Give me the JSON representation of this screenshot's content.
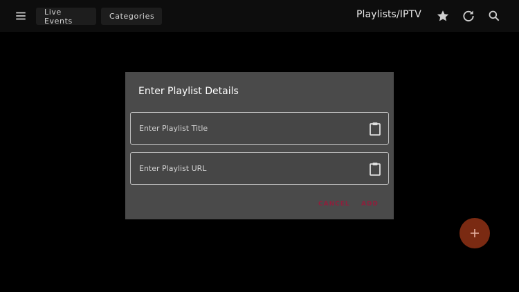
{
  "topbar": {
    "menu_icon": "menu-icon",
    "chips": [
      "Live Events",
      "Categories"
    ],
    "title": "Playlists/IPTV",
    "icons": [
      "star-icon",
      "refresh-icon",
      "search-icon"
    ]
  },
  "dialog": {
    "title": "Enter Playlist Details",
    "title_placeholder": "Enter Playlist Title",
    "title_value": "",
    "url_placeholder": "Enter Playlist URL",
    "url_value": "",
    "paste_icon": "clipboard-icon",
    "cancel_label": "CANCEL",
    "add_label": "ADD"
  },
  "fab": {
    "icon": "plus-icon"
  },
  "colors": {
    "background": "#000000",
    "topbar": "#0d0d0d",
    "dialog": "#4a4a4a",
    "accent": "#8f1f3c",
    "fab": "#7a2a12"
  }
}
